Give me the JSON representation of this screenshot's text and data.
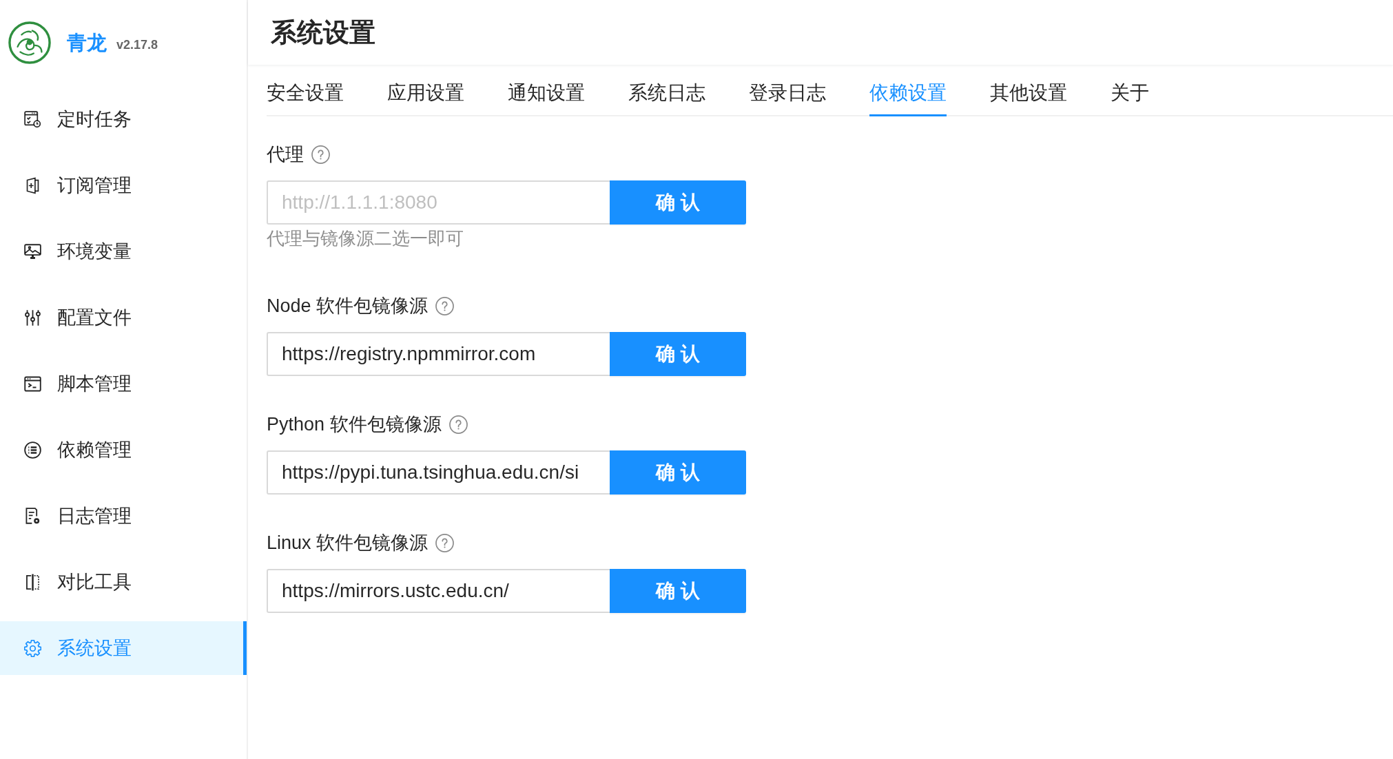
{
  "sidebar": {
    "logo": {
      "title": "青龙",
      "version": "v2.17.8"
    },
    "items": [
      {
        "label": "定时任务",
        "selected": false
      },
      {
        "label": "订阅管理",
        "selected": false
      },
      {
        "label": "环境变量",
        "selected": false
      },
      {
        "label": "配置文件",
        "selected": false
      },
      {
        "label": "脚本管理",
        "selected": false
      },
      {
        "label": "依赖管理",
        "selected": false
      },
      {
        "label": "日志管理",
        "selected": false
      },
      {
        "label": "对比工具",
        "selected": false
      },
      {
        "label": "系统设置",
        "selected": true
      }
    ]
  },
  "header": {
    "title": "系统设置"
  },
  "tabs": [
    {
      "label": "安全设置",
      "selected": false
    },
    {
      "label": "应用设置",
      "selected": false
    },
    {
      "label": "通知设置",
      "selected": false
    },
    {
      "label": "系统日志",
      "selected": false
    },
    {
      "label": "登录日志",
      "selected": false
    },
    {
      "label": "依赖设置",
      "selected": true
    },
    {
      "label": "其他设置",
      "selected": false
    },
    {
      "label": "关于",
      "selected": false
    }
  ],
  "form": {
    "fields": [
      {
        "label": "代理",
        "placeholder": "http://1.1.1.1:8080",
        "hint": "代理与镜像源二选一即可",
        "button": "确 认"
      },
      {
        "label": "Node 软件包镜像源",
        "value": "https://registry.npmmirror.com",
        "button": "确 认"
      },
      {
        "label": "Python 软件包镜像源",
        "value": "https://pypi.tuna.tsinghua.edu.cn/si",
        "button": "确 认"
      },
      {
        "label": "Linux 软件包镜像源",
        "value": "https://mirrors.ustc.edu.cn/",
        "button": "确 认"
      }
    ]
  }
}
